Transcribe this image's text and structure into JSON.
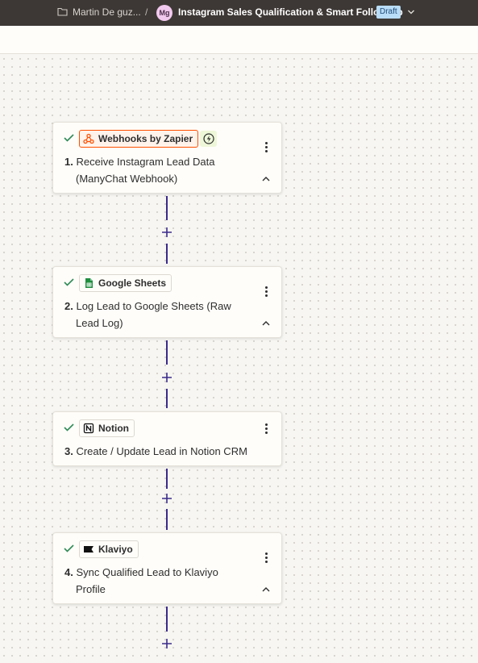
{
  "topbar": {
    "breadcrumb": "Martin De guz...",
    "separator": "/",
    "avatar_initials": "Mg",
    "zap_title": "Instagram Sales Qualification & Smart Follow-Up",
    "status_badge": "Draft"
  },
  "steps": [
    {
      "app": "Webhooks by Zapier",
      "number": "1.",
      "title_line1": "Receive Instagram Lead Data",
      "title_line2": "(ManyChat Webhook)",
      "icon": "webhook-icon",
      "trigger": true
    },
    {
      "app": "Google Sheets",
      "number": "2.",
      "title_line1": "Log Lead to Google Sheets (Raw",
      "title_line2": "Lead Log)",
      "icon": "google-sheets-icon"
    },
    {
      "app": "Notion",
      "number": "3.",
      "title_line1": "Create / Update Lead in Notion CRM",
      "title_line2": "",
      "icon": "notion-icon"
    },
    {
      "app": "Klaviyo",
      "number": "4.",
      "title_line1": "Sync Qualified Lead to Klaviyo",
      "title_line2": "Profile",
      "icon": "klaviyo-icon"
    }
  ],
  "colors": {
    "topbar_bg": "#3d3835",
    "accent": "#3b2b8a",
    "trigger_border": "#ff4f00",
    "check_green": "#2e8b57",
    "draft_bg": "#b9dcf7"
  }
}
